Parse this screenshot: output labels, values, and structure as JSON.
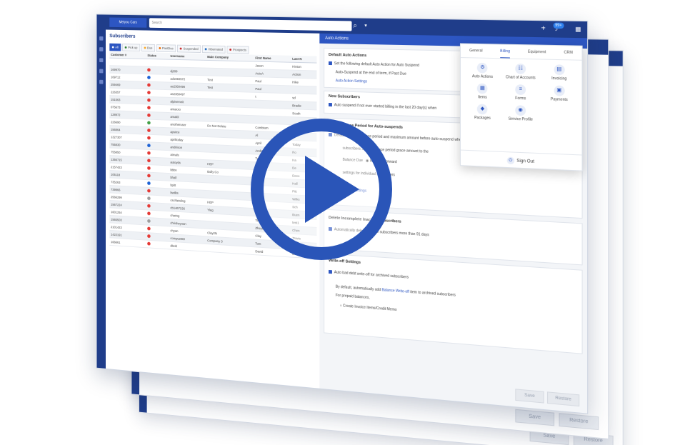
{
  "topbar": {
    "brand": "Meiyou Cars",
    "search_placeholder": "Search",
    "badge": "99+"
  },
  "subscribers": {
    "title": "Subscribers",
    "filters": [
      {
        "label": "All",
        "color": "#2d56c2",
        "active": true
      },
      {
        "label": "Pick up",
        "color": "#2e7d32",
        "active": false
      },
      {
        "label": "Due",
        "color": "#f9a825",
        "active": false
      },
      {
        "label": "PastDue",
        "color": "#ef6c00",
        "active": false
      },
      {
        "label": "Suspended",
        "color": "#c62828",
        "active": false
      },
      {
        "label": "Hibernated",
        "color": "#1565c0",
        "active": false
      },
      {
        "label": "Prospects",
        "color": "#c62828",
        "active": false
      }
    ],
    "columns": [
      "Customer #",
      "Status",
      "Username",
      "Main Company",
      "First Name",
      "Last N"
    ],
    "rows": [
      [
        "",
        "",
        "",
        "",
        "Jason",
        "Hinton"
      ],
      [
        "169970",
        "red",
        "dj299",
        "",
        "AutoA",
        "Action"
      ],
      [
        "169712",
        "blue",
        "ad1693572",
        "Test",
        "Paul",
        "Hike"
      ],
      [
        "259469",
        "red",
        "as2360498",
        "Test",
        "Paul",
        ""
      ],
      [
        "226357",
        "red",
        "as2360497",
        "",
        "t",
        "sd"
      ],
      [
        "151563",
        "red",
        "alpinemeit",
        "",
        "",
        "Bradie"
      ],
      [
        "075673",
        "red",
        "amaxxo",
        "",
        "",
        "South"
      ],
      [
        "128972",
        "red",
        "amakli",
        "",
        "",
        ""
      ],
      [
        "226690",
        "green",
        "anotheruser",
        "Do Not Delete",
        "Combium",
        "Slow"
      ],
      [
        "156864",
        "red",
        "apsinsi",
        "",
        "Al",
        ""
      ],
      [
        "1327307",
        "red",
        "apriltoday",
        "",
        "April",
        "Today"
      ],
      [
        "755830",
        "blue",
        "andriison",
        "",
        "Andree",
        "Ro"
      ],
      [
        "755850",
        "red",
        "atmals",
        "",
        "Tom",
        "Ha"
      ],
      [
        "1356715",
        "red",
        "autoyds",
        "HEP",
        "Randy",
        "De"
      ],
      [
        "2157423",
        "red",
        "bbbn",
        "Bolly Co",
        "Bobby",
        "Dexo"
      ],
      [
        "105118",
        "red",
        "bhall",
        "",
        "Sean",
        "Hall"
      ],
      [
        "735263",
        "blue",
        "bpitt",
        "",
        "Brad",
        "Pitt"
      ],
      [
        "739866",
        "red",
        "bwilks",
        "",
        "Bruce",
        "Wilks"
      ],
      [
        "2566299",
        "gray",
        "cschleisling",
        "HEP",
        "Randy",
        "Sch"
      ],
      [
        "1567224",
        "red",
        "cb1467226",
        "Yleg",
        "Chad",
        "Buen"
      ],
      [
        "1601254",
        "red",
        "chwing",
        "",
        "Test1",
        "test1"
      ],
      [
        "1565503",
        "gray",
        "chrisheyoan",
        "",
        "Zheyoan",
        "Chen"
      ],
      [
        "2101423",
        "red",
        "chyan",
        "Clay2N",
        "Clay",
        "Travis"
      ],
      [
        "1422191",
        "red",
        "compuet69",
        "Company 3",
        "Tom",
        "Banks"
      ],
      [
        "166661",
        "red",
        "dbrdt",
        "",
        "David",
        "Burrnet"
      ]
    ]
  },
  "auto": {
    "header": "Auto Actions",
    "default_heading": "Default Auto Actions",
    "default_line1": "Set the following default Auto Action for Auto Suspend",
    "default_line2": "Auto-Suspend at the end of term, if Past Due",
    "default_link": "Auto Action Settings",
    "new_heading": "New Subscribers",
    "new_line": "Auto suspend if not ever started billing in the last",
    "new_days": "20",
    "new_suffix": "day(s) when",
    "grace_heading": "Default Grace Period for Auto-suspends",
    "grace_line1": "Default maximum grace period and maximum amount before auto-suspend when past due",
    "grace_line2a": "subscribers",
    "grace_value": "3",
    "grace_line2b": "day(s) grace period",
    "grace_line2c": "grace amount to the",
    "grace_opt1": "Balance Due",
    "grace_opt2": "Balance Forward",
    "grace_line3": "settings for individual subscribers",
    "grace_link": "Period Settings",
    "delete_heading": "Delete Incomplete Inactive Subscribers",
    "delete_line": "Automatically delete inactive subscribers more than",
    "delete_days": "91",
    "delete_suffix": "days",
    "wo_heading": "Write-off Settings",
    "wo_line1": "Auto bad debt write-off for archived subscribers",
    "wo_line2a": "By default, automatically add",
    "wo_link": "Balance Write-off",
    "wo_line2b": "item to archived subscribers",
    "wo_line3": "For prepaid balances,",
    "wo_opt": "Create Invoice Items/Credit Memo",
    "save": "Save",
    "restore": "Restore"
  },
  "menu": {
    "tabs": [
      {
        "label": "General",
        "active": false
      },
      {
        "label": "Billing",
        "active": true
      },
      {
        "label": "Equipment",
        "active": false
      },
      {
        "label": "CRM",
        "active": false
      }
    ],
    "items": [
      {
        "label": "Auto Actions",
        "icon": "gear-icon",
        "glyph": "⚙"
      },
      {
        "label": "Chart of Accounts",
        "icon": "accounts-icon",
        "glyph": "☷"
      },
      {
        "label": "Invoicing",
        "icon": "invoice-icon",
        "glyph": "▤"
      },
      {
        "label": "Items",
        "icon": "items-icon",
        "glyph": "▦"
      },
      {
        "label": "Forms",
        "icon": "forms-icon",
        "glyph": "≡"
      },
      {
        "label": "Payments",
        "icon": "payments-icon",
        "glyph": "▣"
      },
      {
        "label": "Packages",
        "icon": "packages-icon",
        "glyph": "◆"
      },
      {
        "label": "Service Profile",
        "icon": "service-icon",
        "glyph": "◉"
      }
    ],
    "signout": "Sign Out"
  },
  "colors": {
    "accent": "#2d56c2",
    "navy": "#1f3d8a",
    "play": "#2a55b8"
  }
}
